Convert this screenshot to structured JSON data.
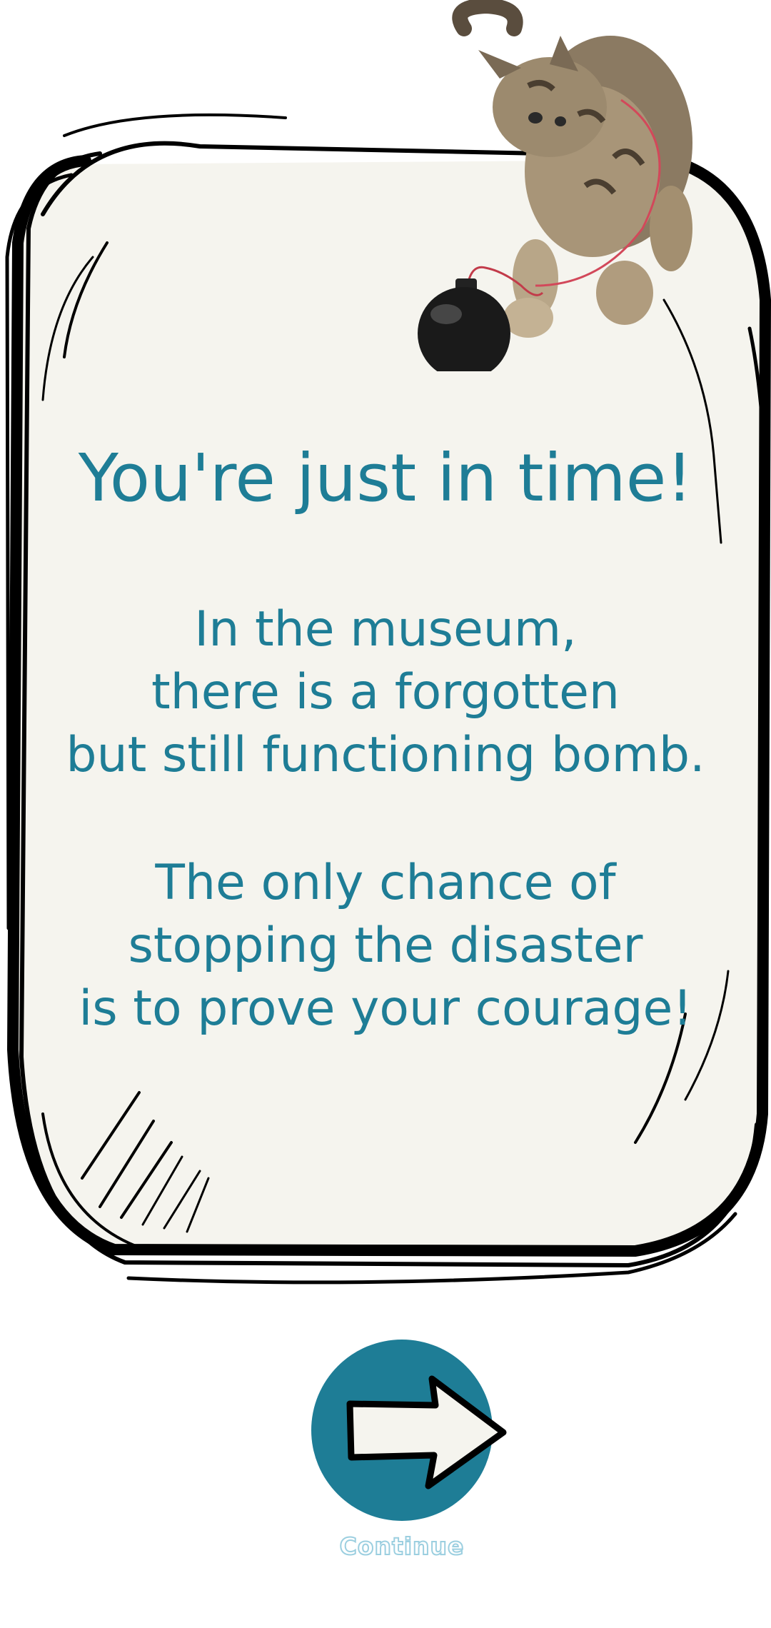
{
  "card": {
    "title": "You're just in time!",
    "paragraph1": [
      "In the museum,",
      "there is a forgotten",
      "but still functioning bomb."
    ],
    "paragraph2": [
      "The only chance of",
      "stopping the disaster",
      "is to prove your courage!"
    ]
  },
  "continue": {
    "label": "Continue",
    "icon": "arrow-right-icon"
  },
  "illustration": {
    "character": "kitten",
    "prop": "bomb"
  },
  "colors": {
    "text": "#1e7d96",
    "button": "#1e7d96",
    "card_fill": "#f5f4ee",
    "frame_stroke": "#000000",
    "label_stroke": "#9ccfe0"
  }
}
